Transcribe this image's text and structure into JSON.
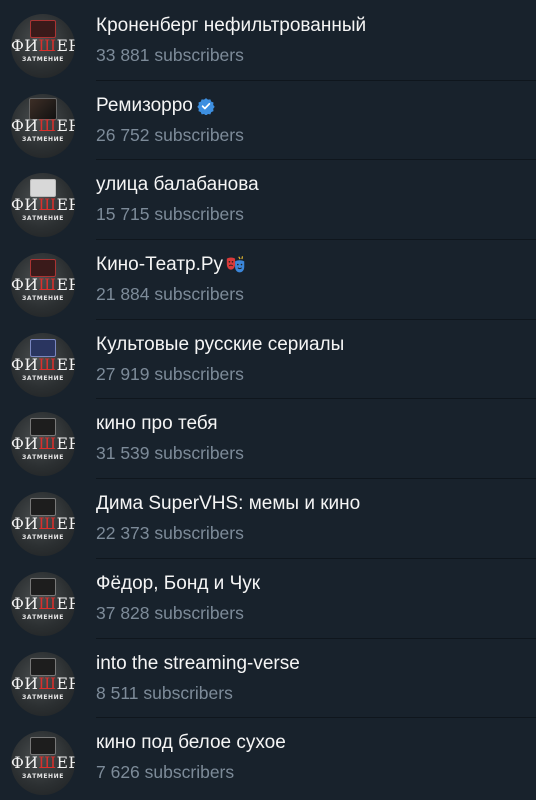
{
  "channels": [
    {
      "title": "Кроненберг нефильтрованный",
      "subscribers": "33 881 subscribers",
      "avatar_brand": [
        "ФИ",
        "Ш",
        "ЕР"
      ],
      "avatar_sub": "ЗАТМЕНИЕ",
      "badge": null
    },
    {
      "title": "Ремизорро",
      "subscribers": "26 752 subscribers",
      "avatar_brand": [
        "ФИ",
        "Ш",
        "ЕР"
      ],
      "avatar_sub": "ЗАТМЕНИЕ",
      "badge": "verified"
    },
    {
      "title": "улица балабанова",
      "subscribers": "15 715 subscribers",
      "avatar_brand": [
        "ФИ",
        "Ш",
        "ЕР"
      ],
      "avatar_sub": "ЗАТМЕНИЕ",
      "badge": null
    },
    {
      "title": "Кино-Театр.Ру",
      "subscribers": "21 884 subscribers",
      "avatar_brand": [
        "ФИ",
        "Ш",
        "ЕР"
      ],
      "avatar_sub": "ЗАТМЕНИЕ",
      "badge": "theater-masks-emoji"
    },
    {
      "title": "Культовые русские сериалы",
      "subscribers": "27 919 subscribers",
      "avatar_brand": [
        "ФИ",
        "Ш",
        "ЕР"
      ],
      "avatar_sub": "ЗАТМЕНИЕ",
      "badge": null
    },
    {
      "title": "кино про тебя",
      "subscribers": "31 539 subscribers",
      "avatar_brand": [
        "ФИ",
        "Ш",
        "ЕР"
      ],
      "avatar_sub": "ЗАТМЕНИЕ",
      "badge": null
    },
    {
      "title": "Дима SuperVHS: мемы и кино",
      "subscribers": "22 373 subscribers",
      "avatar_brand": [
        "ФИ",
        "Ш",
        "ЕР"
      ],
      "avatar_sub": "ЗАТМЕНИЕ",
      "badge": null
    },
    {
      "title": "Фёдор, Бонд и Чук",
      "subscribers": "37 828 subscribers",
      "avatar_brand": [
        "ФИ",
        "Ш",
        "ЕР"
      ],
      "avatar_sub": "ЗАТМЕНИЕ",
      "badge": null
    },
    {
      "title": "into the streaming-verse",
      "subscribers": "8 511 subscribers",
      "avatar_brand": [
        "ФИ",
        "Ш",
        "ЕР"
      ],
      "avatar_sub": "ЗАТМЕНИЕ",
      "badge": null
    },
    {
      "title": "кино под белое сухое",
      "subscribers": "7 626 subscribers",
      "avatar_brand": [
        "ФИ",
        "Ш",
        "ЕР"
      ],
      "avatar_sub": "ЗАТМЕНИЕ",
      "badge": null
    }
  ],
  "colors": {
    "background": "#18222c",
    "title": "#f5f5f5",
    "subscribers": "#7d8b99",
    "verified": "#3d8fe0",
    "brand_accent": "#d9302c"
  }
}
